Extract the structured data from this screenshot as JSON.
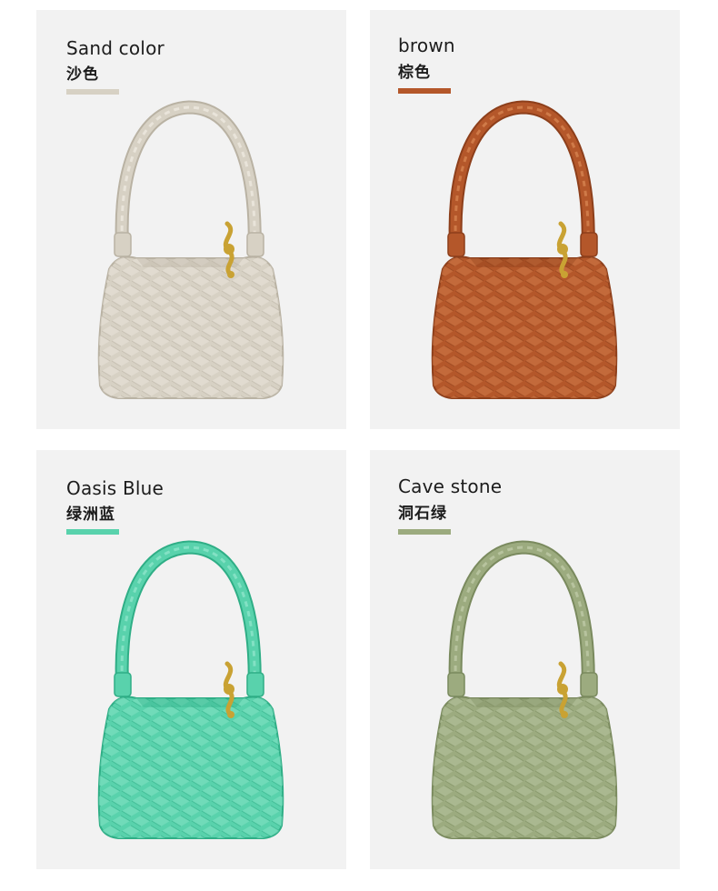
{
  "variants": [
    {
      "name_en": "Sand color",
      "name_zh": "沙色",
      "color": "#d7d1c4",
      "dark": "#b9b2a3",
      "light": "#e9e4da"
    },
    {
      "name_en": "brown",
      "name_zh": "棕色",
      "color": "#b4572a",
      "dark": "#8d3f1b",
      "light": "#cf7a48"
    },
    {
      "name_en": "Oasis Blue",
      "name_zh": "绿洲蓝",
      "color": "#59d2ac",
      "dark": "#2fae86",
      "light": "#83e1c4"
    },
    {
      "name_en": "Cave stone",
      "name_zh": "洞石绿",
      "color": "#9cab7f",
      "dark": "#7a8a5e",
      "light": "#b7c39e"
    }
  ],
  "hardware_color": "#c9a233"
}
